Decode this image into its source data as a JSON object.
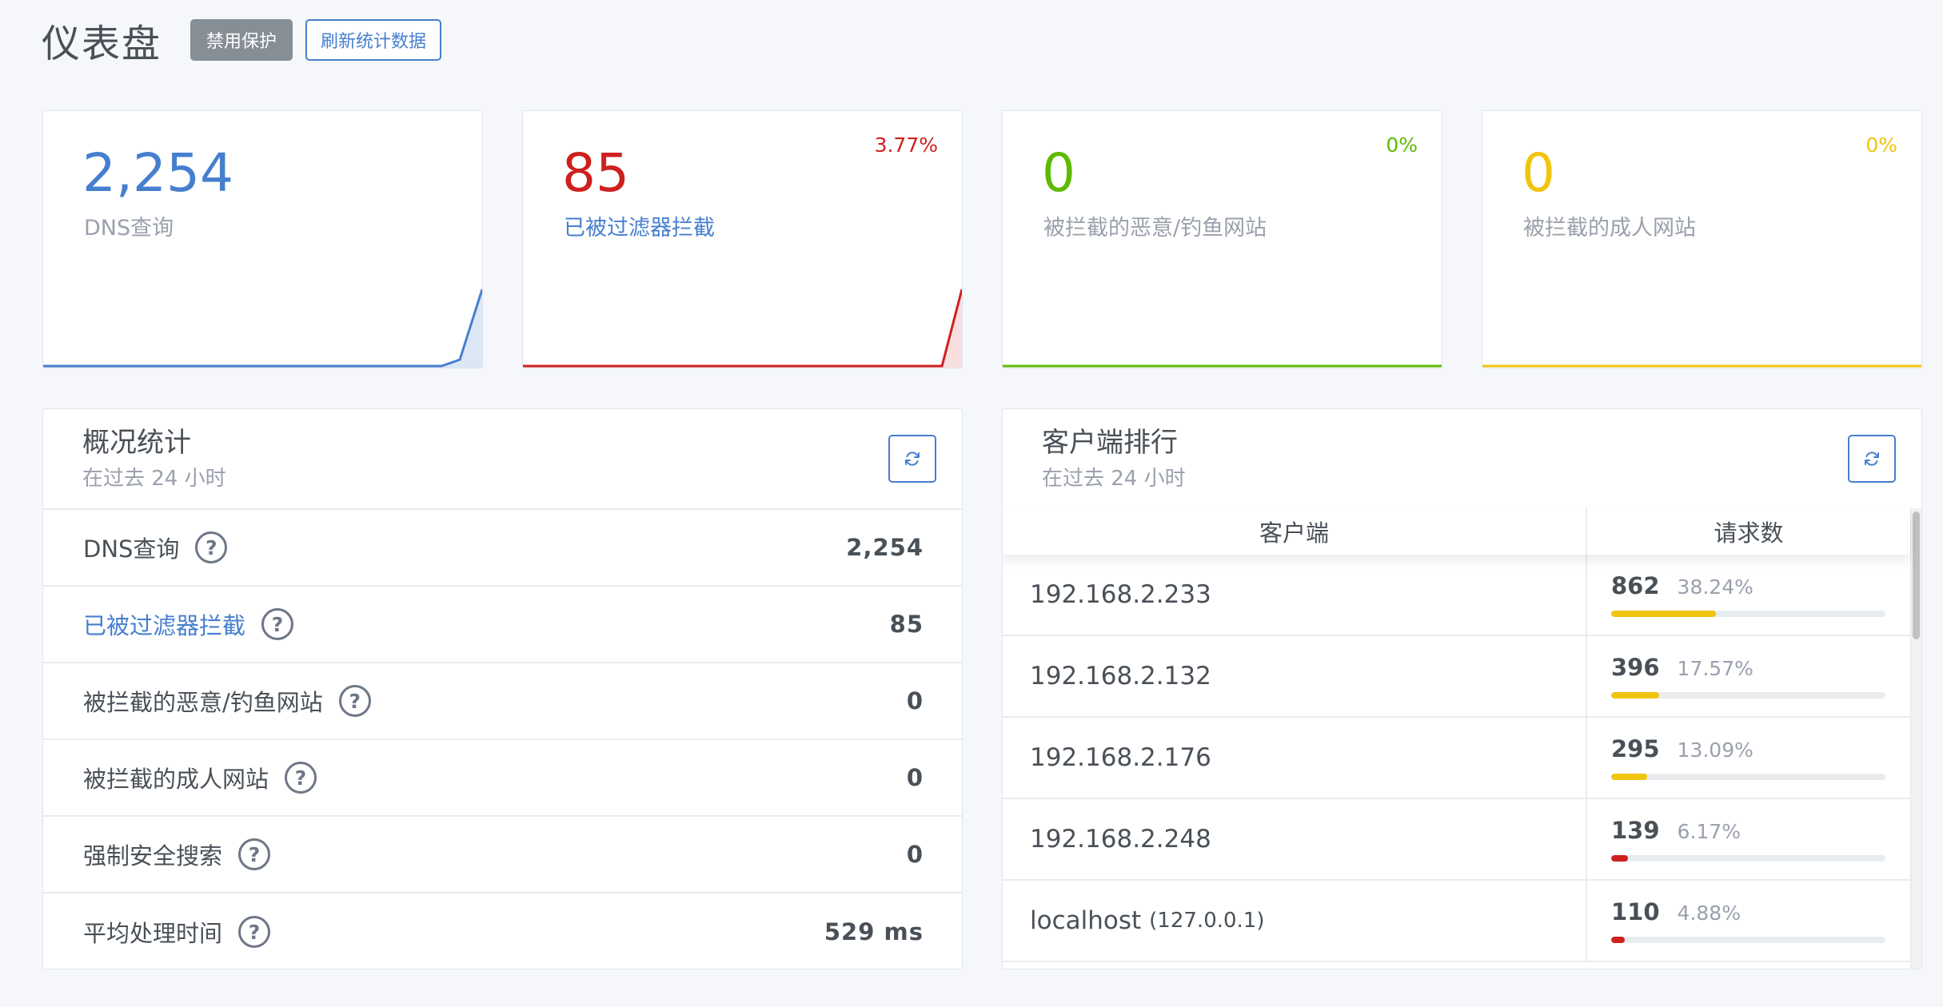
{
  "header": {
    "title": "仪表盘",
    "disable_protection_label": "禁用保护",
    "refresh_stats_label": "刷新统计数据"
  },
  "stat_cards": [
    {
      "value": "2,254",
      "label": "DNS查询",
      "percent": "",
      "color": "#467fcf"
    },
    {
      "value": "85",
      "label": "已被过滤器拦截",
      "percent": "3.77%",
      "color": "#cd201f"
    },
    {
      "value": "0",
      "label": "被拦截的恶意/钓鱼网站",
      "percent": "0%",
      "color": "#5eba00"
    },
    {
      "value": "0",
      "label": "被拦截的成人网站",
      "percent": "0%",
      "color": "#f1c40f"
    }
  ],
  "stats_panel": {
    "title": "概况统计",
    "subtitle": "在过去 24 小时",
    "rows": [
      {
        "label": "DNS查询",
        "value": "2,254"
      },
      {
        "label": "已被过滤器拦截",
        "value": "85"
      },
      {
        "label": "被拦截的恶意/钓鱼网站",
        "value": "0"
      },
      {
        "label": "被拦截的成人网站",
        "value": "0"
      },
      {
        "label": "强制安全搜索",
        "value": "0"
      },
      {
        "label": "平均处理时间",
        "value": "529 ms"
      }
    ],
    "help_glyph": "?"
  },
  "clients_panel": {
    "title": "客户端排行",
    "subtitle": "在过去 24 小时",
    "columns": {
      "client": "客户端",
      "requests": "请求数"
    },
    "rows": [
      {
        "client": "192.168.2.233",
        "client_sub": "",
        "count": "862",
        "percent": "38.24%",
        "share": 0.3824,
        "bar_color": "#f1c40f"
      },
      {
        "client": "192.168.2.132",
        "client_sub": "",
        "count": "396",
        "percent": "17.57%",
        "share": 0.1757,
        "bar_color": "#f1c40f"
      },
      {
        "client": "192.168.2.176",
        "client_sub": "",
        "count": "295",
        "percent": "13.09%",
        "share": 0.1309,
        "bar_color": "#f1c40f"
      },
      {
        "client": "192.168.2.248",
        "client_sub": "",
        "count": "139",
        "percent": "6.17%",
        "share": 0.0617,
        "bar_color": "#cd201f"
      },
      {
        "client": "localhost",
        "client_sub": "(127.0.0.1)",
        "count": "110",
        "percent": "4.88%",
        "share": 0.0488,
        "bar_color": "#cd201f"
      }
    ]
  },
  "icons": {
    "refresh": "refresh-icon",
    "help": "help-icon"
  }
}
